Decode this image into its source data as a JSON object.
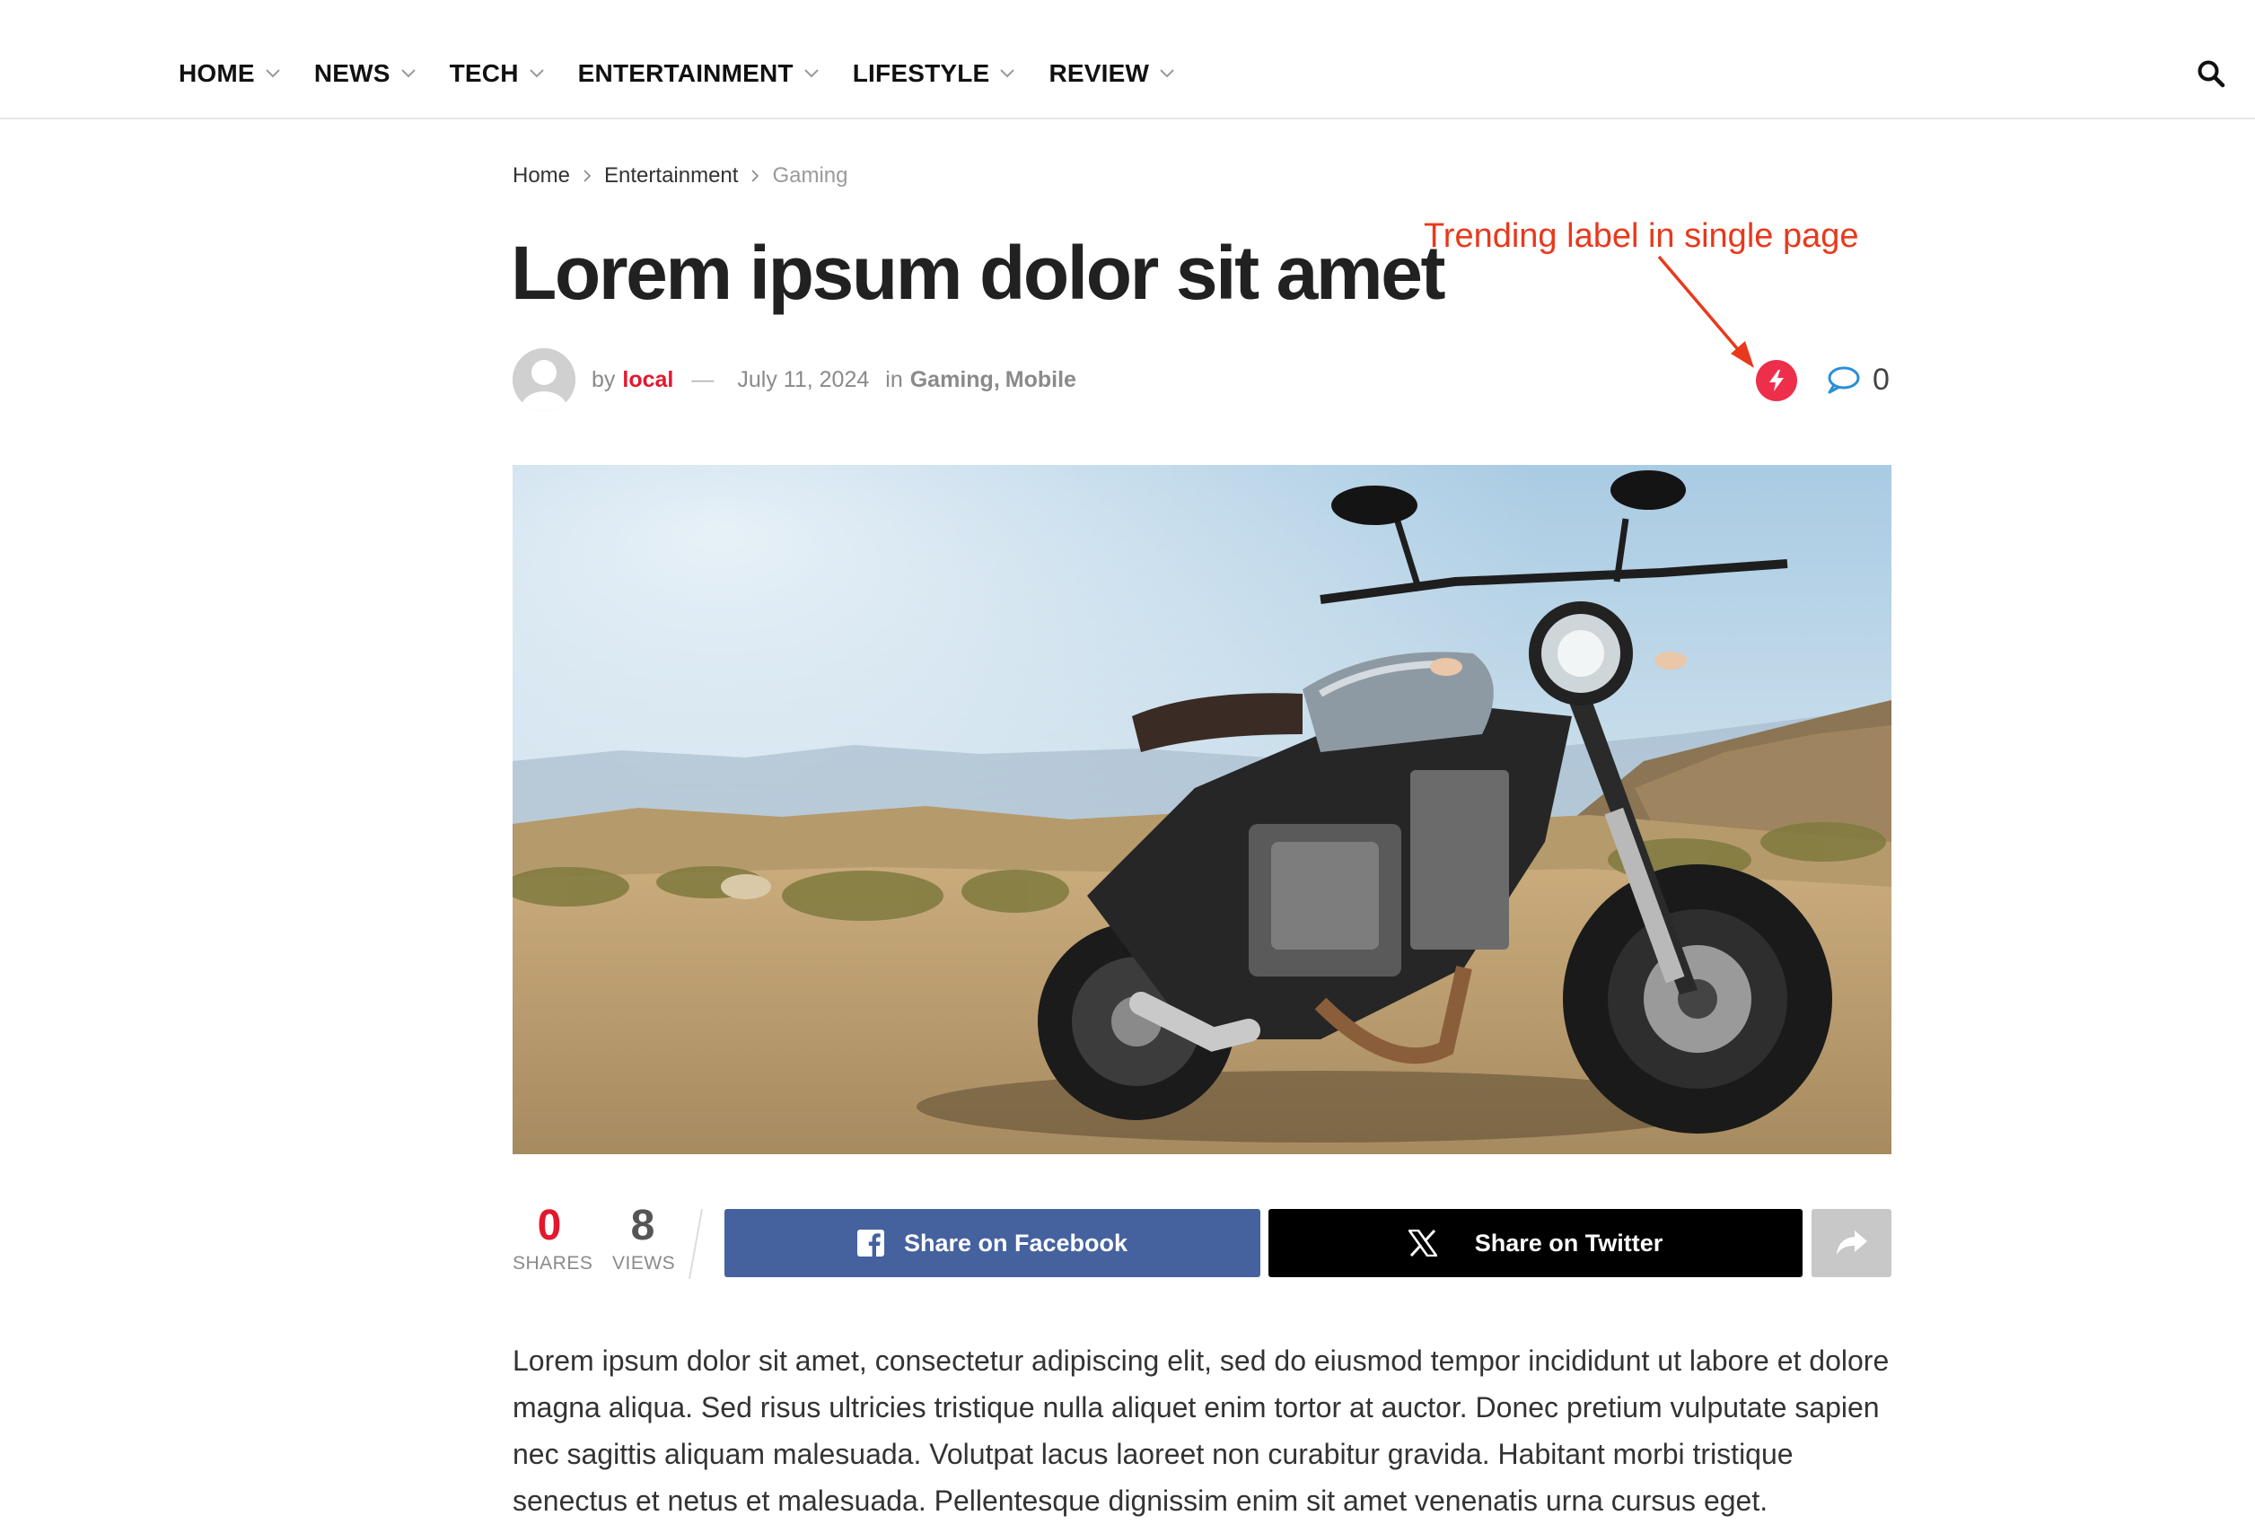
{
  "nav": {
    "items": [
      {
        "label": "HOME"
      },
      {
        "label": "NEWS"
      },
      {
        "label": "TECH"
      },
      {
        "label": "ENTERTAINMENT"
      },
      {
        "label": "LIFESTYLE"
      },
      {
        "label": "REVIEW"
      }
    ],
    "search_icon": "search-icon"
  },
  "breadcrumb": {
    "items": [
      "Home",
      "Entertainment",
      "Gaming"
    ]
  },
  "post": {
    "title": "Lorem ipsum dolor sit amet",
    "meta": {
      "by": "by",
      "author": "local",
      "dash": "—",
      "date": "July 11, 2024",
      "in": "in",
      "categories": [
        "Gaming",
        "Mobile"
      ],
      "separator": ","
    },
    "comments_count": "0",
    "trending_icon": "lightning-icon"
  },
  "annotation": {
    "text": "Trending label in single page",
    "color": "#e8391c"
  },
  "share": {
    "shares_count": "0",
    "shares_label": "SHARES",
    "views_count": "8",
    "views_label": "VIEWS",
    "facebook_label": "Share on Facebook",
    "twitter_label": "Share on Twitter",
    "more_icon": "share-arrow-icon"
  },
  "content": {
    "paragraph": "Lorem ipsum dolor sit amet, consectetur adipiscing elit, sed do eiusmod tempor incididunt ut labore et dolore magna aliqua. Sed risus ultricies tristique nulla aliquet enim tortor at auctor. Donec pretium vulputate sapien nec sagittis aliquam malesuada. Volutpat lacus laoreet non curabitur gravida. Habitant morbi tristique senectus et netus et malesuada. Pellentesque dignissim enim sit amet venenatis urna cursus eget."
  },
  "colors": {
    "accent_red": "#e3182d",
    "trending_red": "#ee2f4b",
    "facebook_blue": "#45629f",
    "twitter_black": "#000000",
    "comment_blue": "#2a8fd6"
  }
}
